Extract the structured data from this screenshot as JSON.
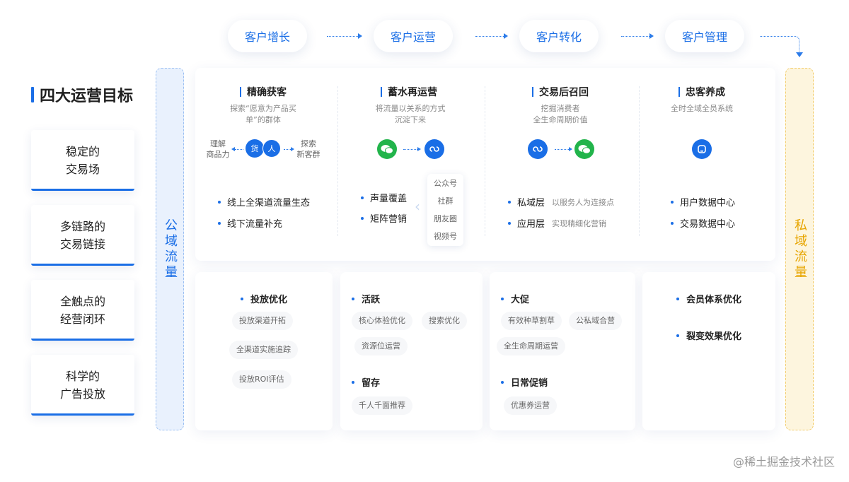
{
  "flow": [
    "客户增长",
    "客户运营",
    "客户转化",
    "客户管理"
  ],
  "goals": {
    "title": "四大运营目标",
    "items": [
      "稳定的\n交易场",
      "多链路的\n交易链接",
      "全触点的\n经营闭环",
      "科学的\n广告投放"
    ]
  },
  "columns": {
    "public": "公域流量",
    "private": "私域流量"
  },
  "stages": [
    {
      "title": "精确获客",
      "desc": "探索“愿意为产品买\n单”的群体"
    },
    {
      "title": "蓄水再运营",
      "desc": "将流量以关系的方式\n沉淀下来"
    },
    {
      "title": "交易后召回",
      "desc": "挖掘消费者\n全生命周期价值"
    },
    {
      "title": "忠客养成",
      "desc": "全时全域全员系统"
    }
  ],
  "stage1": {
    "left_label": "理解\n商品力",
    "right_label": "探索\n新客群",
    "circle_a": "货",
    "circle_b": "人",
    "bullets": [
      "线上全渠道流量生态",
      "线下流量补充"
    ]
  },
  "stage2": {
    "bullets": [
      "声量覆盖",
      "矩阵营销"
    ],
    "channels": [
      "公众号",
      "社群",
      "朋友圈",
      "视频号"
    ]
  },
  "stage3": {
    "bullets": [
      {
        "label": "私域层",
        "sub": "以服务人为连接点"
      },
      {
        "label": "应用层",
        "sub": "实现精细化营销"
      }
    ]
  },
  "stage4": {
    "bullets": [
      "用户数据中心",
      "交易数据中心"
    ]
  },
  "lower": {
    "card1": {
      "title": "投放优化",
      "tags": [
        "投放渠道开拓",
        "全渠道实施追踪",
        "投放ROI评估"
      ]
    },
    "card2": {
      "title1": "活跃",
      "tags1": [
        "核心体验优化",
        "搜索优化",
        "资源位运营"
      ],
      "title2": "留存",
      "tags2": [
        "千人千面推荐"
      ]
    },
    "card3": {
      "title1": "大促",
      "tags1": [
        "有效种草割草",
        "公私域合营",
        "全生命周期运营"
      ],
      "title2": "日常促销",
      "tags2": [
        "优惠券运营"
      ]
    },
    "card4": {
      "titles": [
        "会员体系优化",
        "裂变效果优化"
      ]
    }
  },
  "watermark": "@稀土掘金技术社区",
  "icons": [
    "wechat-icon",
    "mini-program-icon",
    "app-icon"
  ],
  "colors": {
    "accent": "#1a6ee6",
    "wechat": "#22b44b",
    "private": "#e7a500"
  }
}
